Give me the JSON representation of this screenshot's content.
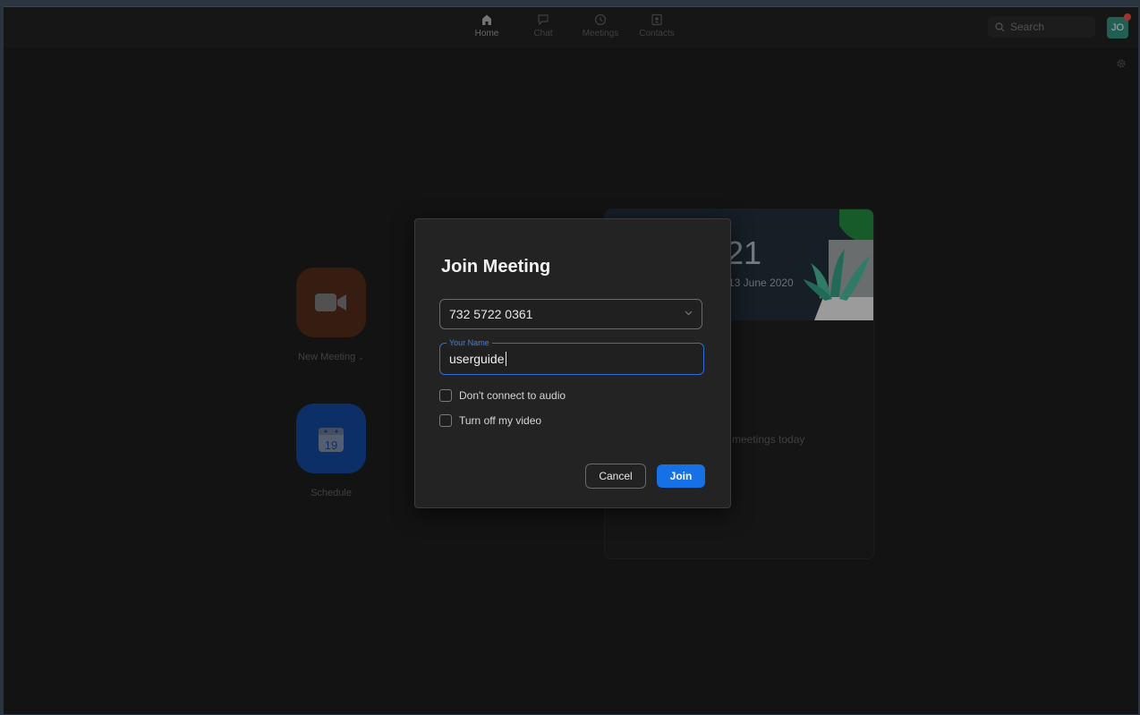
{
  "nav": {
    "home": "Home",
    "chat": "Chat",
    "meetings": "Meetings",
    "contacts": "Contacts"
  },
  "search": {
    "placeholder": "Search"
  },
  "avatar": {
    "initials": "JO"
  },
  "actions": {
    "new_meeting": "New Meeting",
    "schedule": "Schedule",
    "schedule_day": "19"
  },
  "calendar": {
    "clock": ":21",
    "date": "13 June 2020",
    "empty": "meetings today"
  },
  "dialog": {
    "title": "Join Meeting",
    "meeting_id": "732 5722 0361",
    "name_label": "Your Name",
    "name_value": "userguide",
    "audio_option": "Don't connect to audio",
    "video_option": "Turn off my video",
    "cancel": "Cancel",
    "join": "Join"
  },
  "colors": {
    "accent": "#1670e6",
    "new_meeting": "#7a2e16",
    "schedule": "#1250b6",
    "avatar": "#2e7f6e"
  }
}
